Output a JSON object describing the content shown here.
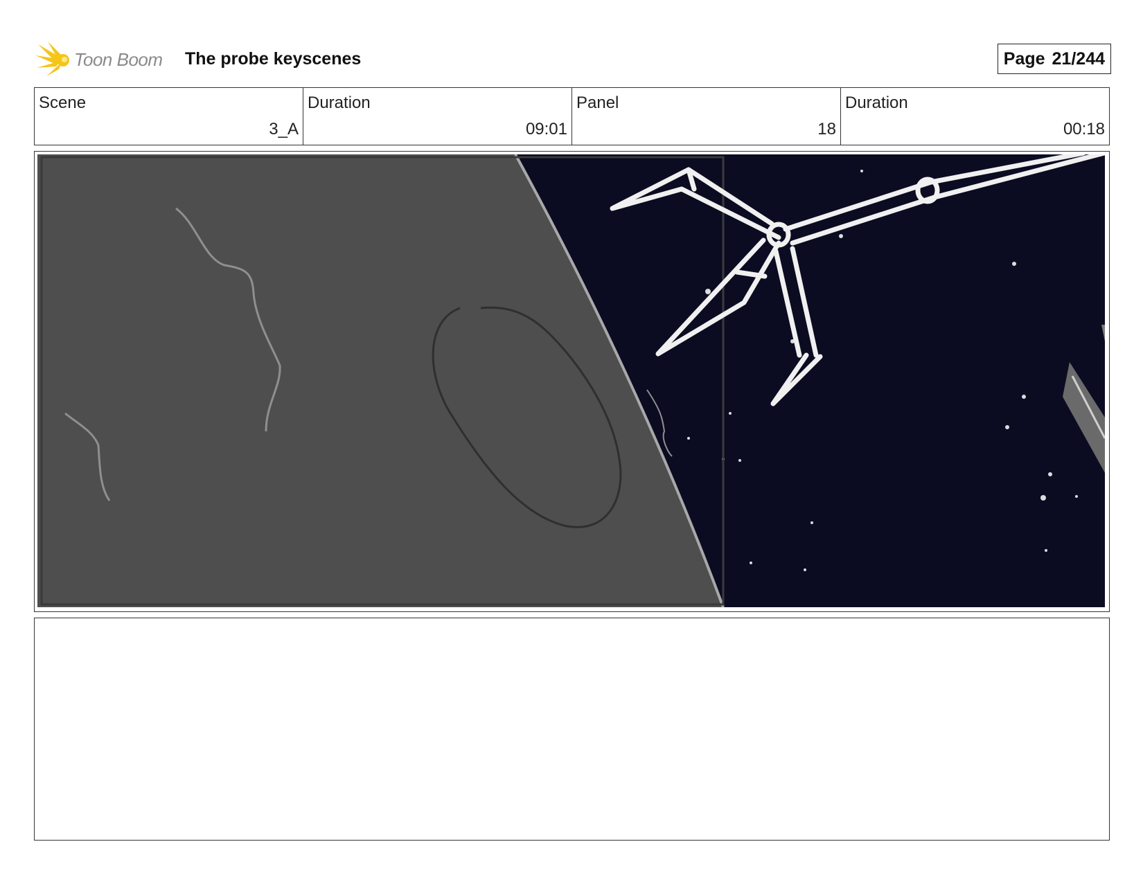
{
  "header": {
    "logo_text": "Toon Boom",
    "project_title": "The probe keyscenes",
    "page_label": "Page",
    "page_value": "21/244"
  },
  "info": [
    {
      "label": "Scene",
      "value": "3_A"
    },
    {
      "label": "Duration",
      "value": "09:01"
    },
    {
      "label": "Panel",
      "value": "18"
    },
    {
      "label": "Duration",
      "value": "00:18"
    }
  ],
  "colors": {
    "logo_yellow": "#f5c518",
    "planet_gray": "#4d4d4d",
    "space_dark": "#0b0c22",
    "sketch_white": "#f2f2f2"
  },
  "notes": {
    "text": ""
  }
}
